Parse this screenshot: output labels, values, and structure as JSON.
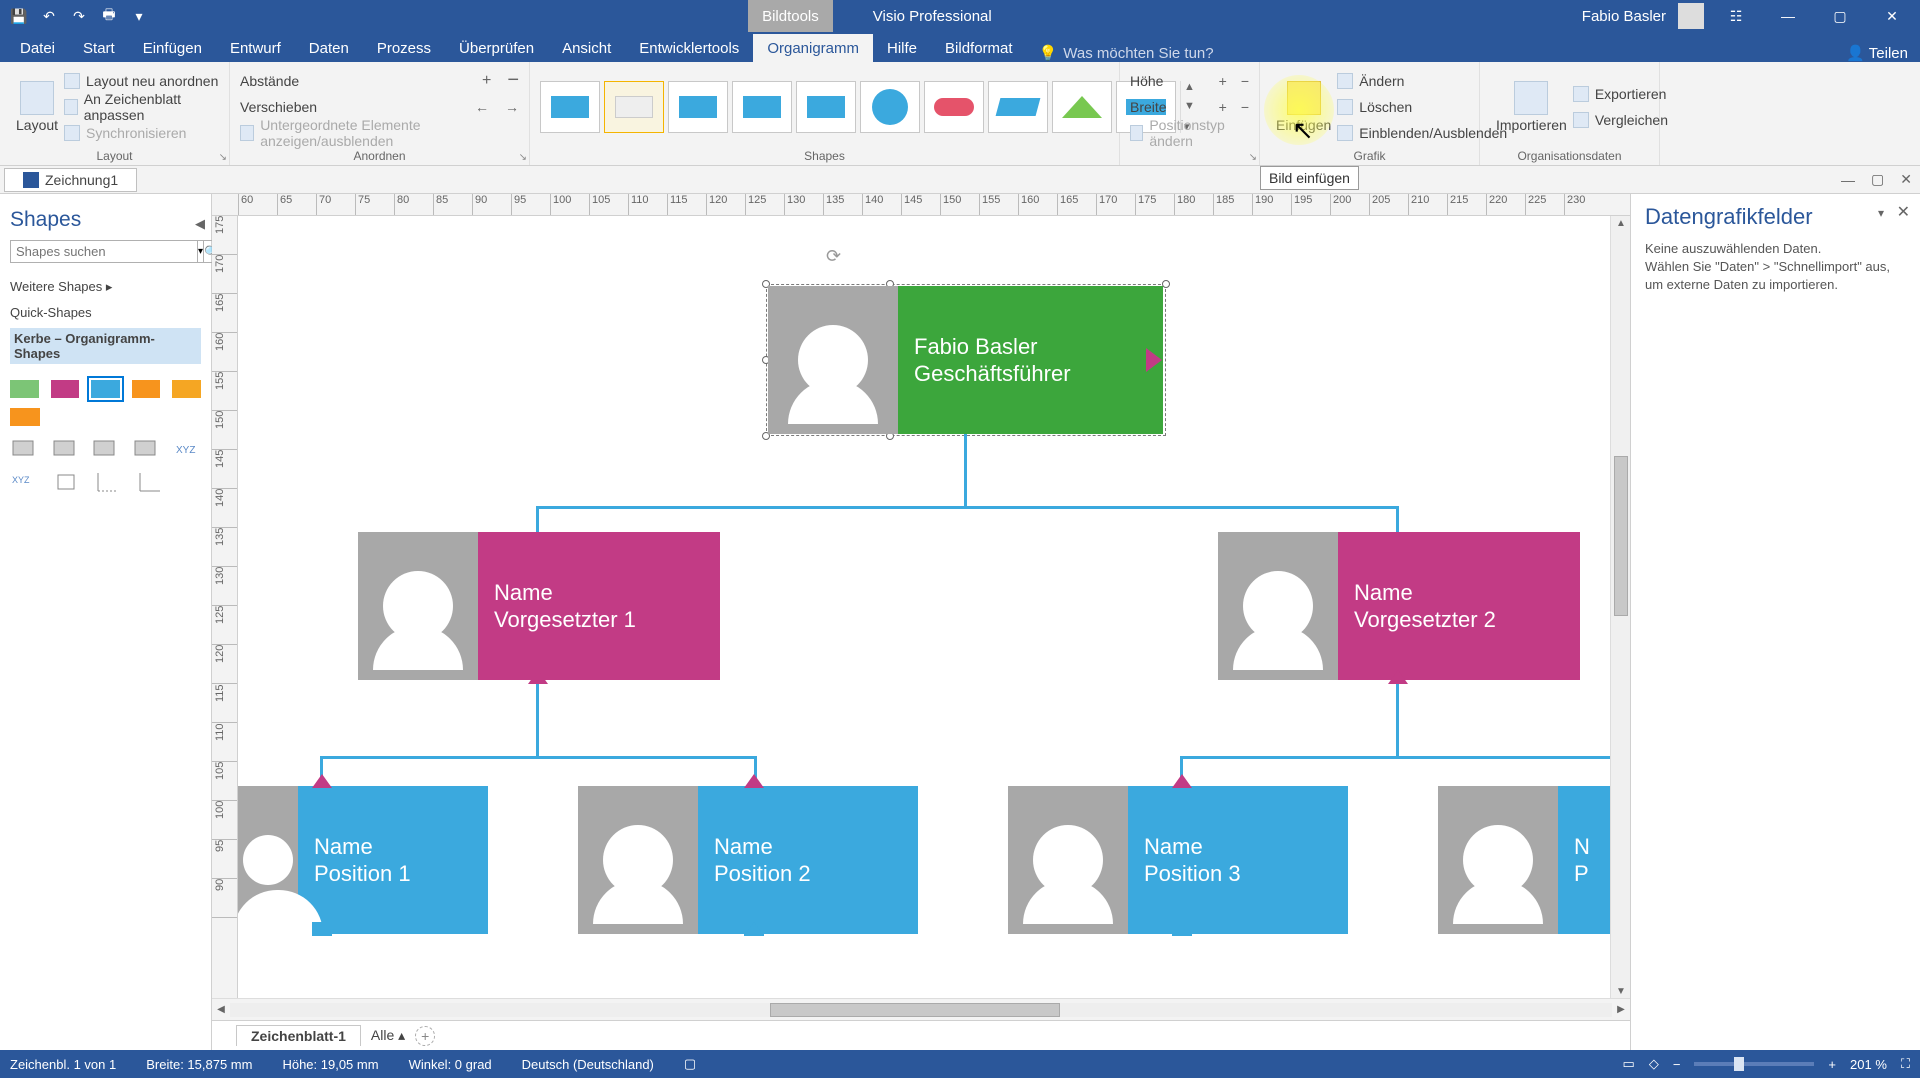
{
  "titlebar": {
    "tool_tab": "Bildtools",
    "app": "Visio Professional",
    "user": "Fabio Basler"
  },
  "qat": {
    "save": "💾",
    "undo": "↶",
    "redo": "↷",
    "print": "🖶",
    "dd": "▾"
  },
  "winbtns": {
    "notes": "☷",
    "min": "—",
    "max": "▢",
    "close": "✕"
  },
  "tabs": [
    "Datei",
    "Start",
    "Einfügen",
    "Entwurf",
    "Daten",
    "Prozess",
    "Überprüfen",
    "Ansicht",
    "Entwicklertools",
    "Organigramm",
    "Hilfe",
    "Bildformat"
  ],
  "tabs_selected": "Organigramm",
  "tellme": "Was möchten Sie tun?",
  "teilen": "Teilen",
  "ribbon": {
    "layout": {
      "big": "Layout",
      "items": [
        "Layout neu anordnen",
        "An Zeichenblatt anpassen",
        "Synchronisieren"
      ],
      "group": "Layout"
    },
    "arrange": {
      "row1_l": "Abstände",
      "row2_l": "Verschieben",
      "row3_l": "Untergeordnete Elemente anzeigen/ausblenden",
      "group": "Anordnen"
    },
    "shapes_group": "Shapes",
    "size": {
      "h": "Höhe",
      "w": "Breite",
      "pos": "Positionstyp ändern"
    },
    "grafik": {
      "einf": "Einfügen",
      "andern": "Ändern",
      "loeschen": "Löschen",
      "einbl": "Einblenden/Ausblenden",
      "group": "Grafik"
    },
    "org": {
      "imp": "Importieren",
      "exp": "Exportieren",
      "verg": "Vergleichen",
      "group": "Organisationsdaten"
    }
  },
  "tooltip": "Bild einfügen",
  "doctab": "Zeichnung1",
  "shapes_panel": {
    "title": "Shapes",
    "search_ph": "Shapes suchen",
    "items": [
      "Weitere Shapes",
      "Quick-Shapes",
      "Kerbe – Organigramm-Shapes"
    ]
  },
  "ruler_h": [
    60,
    65,
    70,
    75,
    80,
    85,
    90,
    95,
    100,
    105,
    110,
    115,
    120,
    125,
    130,
    135,
    140,
    145,
    150,
    155,
    160,
    165,
    170,
    175,
    180,
    185,
    190,
    195,
    200,
    205,
    210,
    215,
    220,
    225,
    230
  ],
  "ruler_v": [
    175,
    170,
    165,
    160,
    155,
    150,
    145,
    140,
    135,
    130,
    125,
    120,
    115,
    110,
    105,
    100,
    95,
    90
  ],
  "nodes": {
    "ceo": {
      "name": "Fabio Basler",
      "title": "Geschäftsführer"
    },
    "m1": {
      "name": "Name",
      "title": "Vorgesetzter 1"
    },
    "m2": {
      "name": "Name",
      "title": "Vorgesetzter 2"
    },
    "p1": {
      "name": "Name",
      "title": "Position 1"
    },
    "p2": {
      "name": "Name",
      "title": "Position 2"
    },
    "p3": {
      "name": "Name",
      "title": "Position 3"
    },
    "p4": {
      "name": "N",
      "title": "P"
    }
  },
  "rpanel": {
    "title": "Datengrafikfelder",
    "body": "Keine auszuwählenden Daten.\nWählen Sie \"Daten\" > \"Schnellimport\" aus, um externe Daten zu importieren."
  },
  "pages": {
    "tab": "Zeichenblatt-1",
    "all": "Alle"
  },
  "status": {
    "page": "Zeichenbl. 1 von 1",
    "breite": "Breite: 15,875 mm",
    "hoehe": "Höhe: 19,05 mm",
    "winkel": "Winkel: 0 grad",
    "lang": "Deutsch (Deutschland)",
    "zoom": "201 %"
  }
}
